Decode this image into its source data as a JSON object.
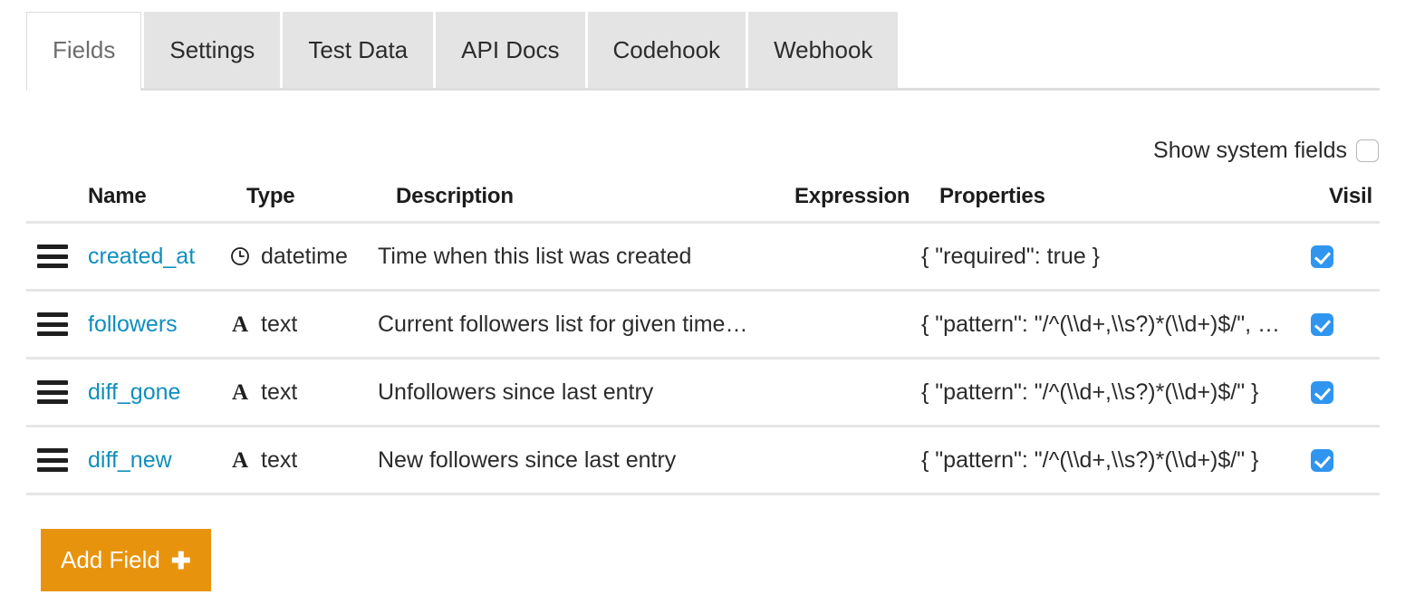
{
  "tabs": [
    {
      "label": "Fields",
      "active": true
    },
    {
      "label": "Settings",
      "active": false
    },
    {
      "label": "Test Data",
      "active": false
    },
    {
      "label": "API Docs",
      "active": false
    },
    {
      "label": "Codehook",
      "active": false
    },
    {
      "label": "Webhook",
      "active": false
    }
  ],
  "toolbar": {
    "show_system_fields_label": "Show system fields",
    "show_system_fields_checked": false
  },
  "table": {
    "headers": {
      "handle": "",
      "name": "Name",
      "type": "Type",
      "description": "Description",
      "expression": "Expression",
      "properties": "Properties",
      "visible": "Visil"
    },
    "rows": [
      {
        "handle_icon": "drag-handle-icon",
        "name": "created_at",
        "type_icon": "clock-icon",
        "type": "datetime",
        "description": "Time when this list was created",
        "expression": "",
        "properties": "{ \"required\": true }",
        "visible_checked": true
      },
      {
        "handle_icon": "drag-handle-icon",
        "name": "followers",
        "type_icon": "text-A-icon",
        "type": "text",
        "description": "Current followers list for given time…",
        "expression": "",
        "properties": "{ \"pattern\": \"/^(\\\\d+,\\\\s?)*(\\\\d+)$/\", …",
        "visible_checked": true
      },
      {
        "handle_icon": "drag-handle-icon",
        "name": "diff_gone",
        "type_icon": "text-A-icon",
        "type": "text",
        "description": "Unfollowers since last entry",
        "expression": "",
        "properties": "{ \"pattern\": \"/^(\\\\d+,\\\\s?)*(\\\\d+)$/\" }",
        "visible_checked": true
      },
      {
        "handle_icon": "drag-handle-icon",
        "name": "diff_new",
        "type_icon": "text-A-icon",
        "type": "text",
        "description": "New followers since last entry",
        "expression": "",
        "properties": "{ \"pattern\": \"/^(\\\\d+,\\\\s?)*(\\\\d+)$/\" }",
        "visible_checked": true
      }
    ]
  },
  "actions": {
    "add_field_label": "Add Field",
    "add_field_plus": "➕"
  },
  "colors": {
    "accent_orange": "#e8930d",
    "link_blue": "#0f8fbd",
    "checkbox_blue": "#2f95ef",
    "tab_inactive_bg": "#e4e4e4",
    "border_gray": "#e6e6e6"
  }
}
